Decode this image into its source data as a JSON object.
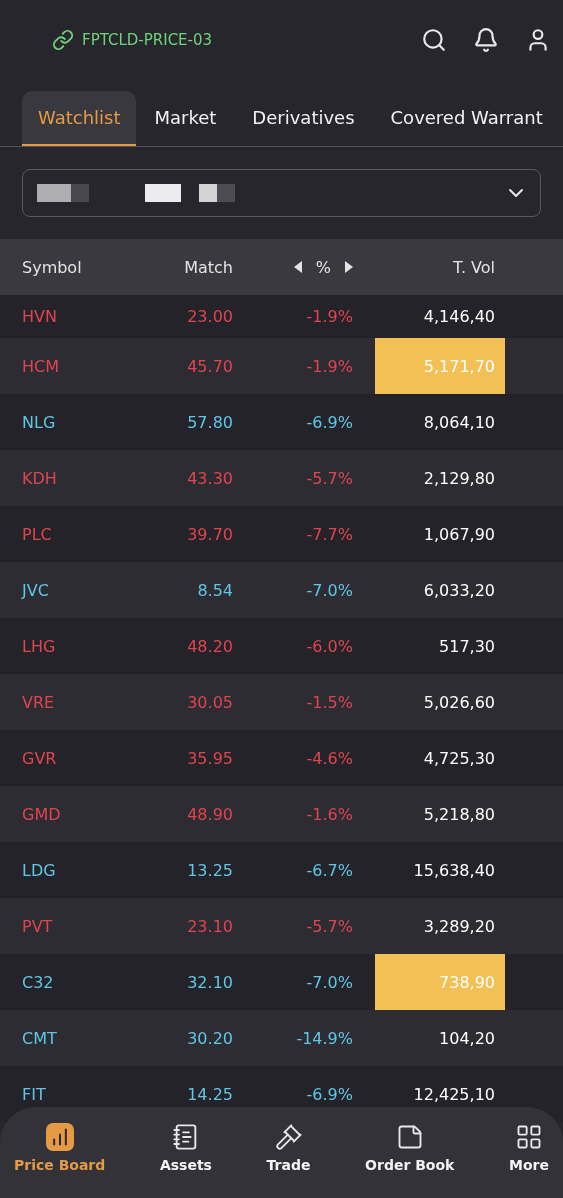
{
  "connection": {
    "label": "FPTCLD-PRICE-03"
  },
  "tabs": [
    {
      "label": "Watchlist",
      "selected": true
    },
    {
      "label": "Market",
      "selected": false
    },
    {
      "label": "Derivatives",
      "selected": false
    },
    {
      "label": "Covered Warrant",
      "selected": false
    }
  ],
  "table": {
    "columns": [
      "Symbol",
      "Match",
      "%",
      "T. Vol"
    ],
    "rows": [
      {
        "symbol": "HVN",
        "match": "23.00",
        "pct": "-1.9%",
        "vol": "4,146,40",
        "color": "#e0444f",
        "highlighted": false
      },
      {
        "symbol": "HCM",
        "match": "45.70",
        "pct": "-1.9%",
        "vol": "5,171,70",
        "color": "#e0444f",
        "highlighted": true
      },
      {
        "symbol": "NLG",
        "match": "57.80",
        "pct": "-6.9%",
        "vol": "8,064,10",
        "color": "#5fc7e6",
        "highlighted": false
      },
      {
        "symbol": "KDH",
        "match": "43.30",
        "pct": "-5.7%",
        "vol": "2,129,80",
        "color": "#e0444f",
        "highlighted": false
      },
      {
        "symbol": "PLC",
        "match": "39.70",
        "pct": "-7.7%",
        "vol": "1,067,90",
        "color": "#e0444f",
        "highlighted": false
      },
      {
        "symbol": "JVC",
        "match": "8.54",
        "pct": "-7.0%",
        "vol": "6,033,20",
        "color": "#5fc7e6",
        "highlighted": false
      },
      {
        "symbol": "LHG",
        "match": "48.20",
        "pct": "-6.0%",
        "vol": "517,30",
        "color": "#e0444f",
        "highlighted": false
      },
      {
        "symbol": "VRE",
        "match": "30.05",
        "pct": "-1.5%",
        "vol": "5,026,60",
        "color": "#e0444f",
        "highlighted": false
      },
      {
        "symbol": "GVR",
        "match": "35.95",
        "pct": "-4.6%",
        "vol": "4,725,30",
        "color": "#e0444f",
        "highlighted": false
      },
      {
        "symbol": "GMD",
        "match": "48.90",
        "pct": "-1.6%",
        "vol": "5,218,80",
        "color": "#e0444f",
        "highlighted": false
      },
      {
        "symbol": "LDG",
        "match": "13.25",
        "pct": "-6.7%",
        "vol": "15,638,40",
        "color": "#5fc7e6",
        "highlighted": false
      },
      {
        "symbol": "PVT",
        "match": "23.10",
        "pct": "-5.7%",
        "vol": "3,289,20",
        "color": "#e0444f",
        "highlighted": false
      },
      {
        "symbol": "C32",
        "match": "32.10",
        "pct": "-7.0%",
        "vol": "738,90",
        "color": "#5fc7e6",
        "highlighted": true
      },
      {
        "symbol": "CMT",
        "match": "30.20",
        "pct": "-14.9%",
        "vol": "104,20",
        "color": "#5fc7e6",
        "highlighted": false
      },
      {
        "symbol": "FIT",
        "match": "14.25",
        "pct": "-6.9%",
        "vol": "12,425,10",
        "color": "#5fc7e6",
        "highlighted": false
      }
    ]
  },
  "nav": [
    {
      "label": "Price Board",
      "kind": "chart",
      "selected": true
    },
    {
      "label": "Assets",
      "kind": "assets",
      "selected": false
    },
    {
      "label": "Trade",
      "kind": "trade",
      "selected": false
    },
    {
      "label": "Order Book",
      "kind": "orders",
      "selected": false
    },
    {
      "label": "More",
      "kind": "more",
      "selected": false
    }
  ]
}
